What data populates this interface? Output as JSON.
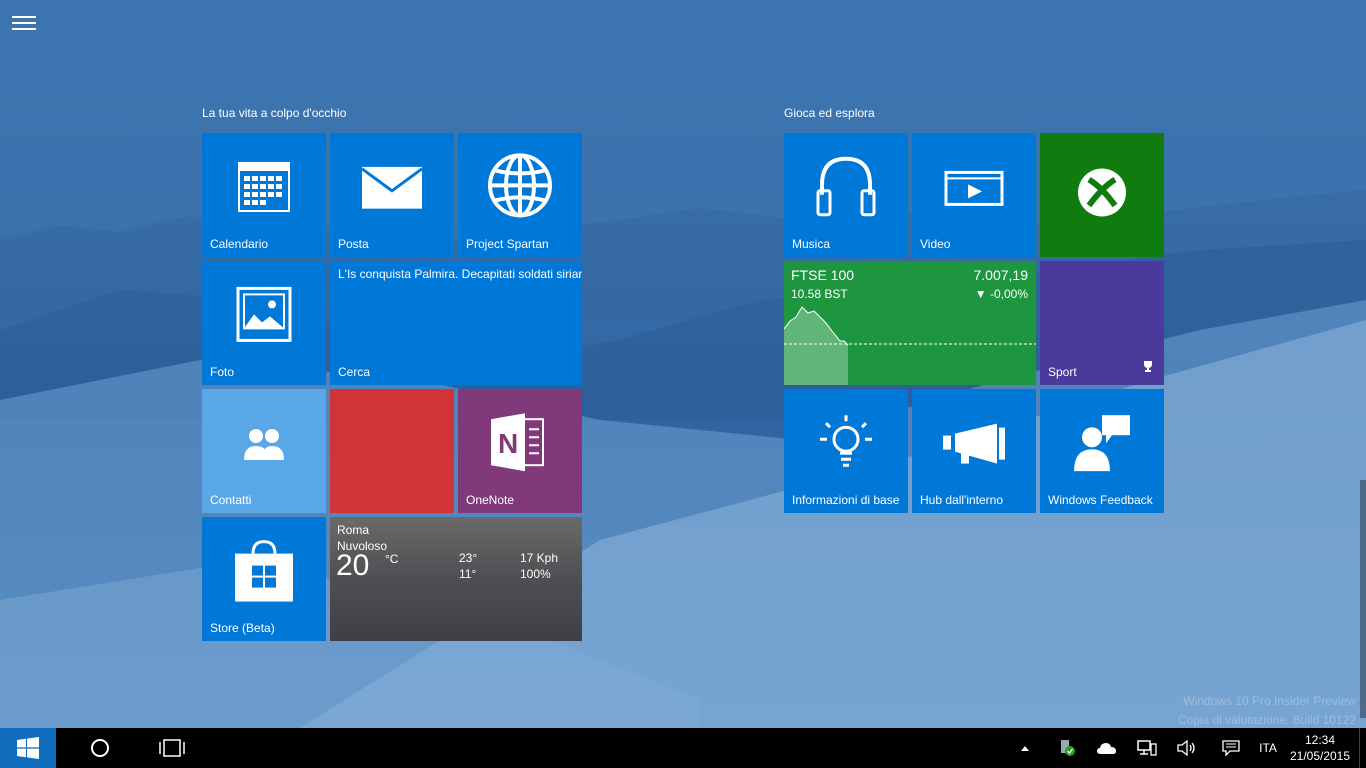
{
  "groups": {
    "left_title": "La tua vita a colpo d'occhio",
    "right_title": "Gioca ed esplora"
  },
  "tiles": {
    "calendar": "Calendario",
    "mail": "Posta",
    "spartan": "Project Spartan",
    "photos": "Foto",
    "search": "Cerca",
    "search_headline": "L'Is conquista Palmira. Decapitati soldati siriani",
    "contacts": "Contatti",
    "onenote": "OneNote",
    "store": "Store (Beta)",
    "music": "Musica",
    "video": "Video",
    "sport": "Sport",
    "tips": "Informazioni di base",
    "insider_hub": "Hub dall'interno",
    "feedback": "Windows Feedback"
  },
  "weather": {
    "city": "Roma",
    "condition": "Nuvoloso",
    "temp": "20",
    "unit": "°C",
    "high": "23°",
    "low": "11°",
    "wind": "17 Kph",
    "humidity": "100%"
  },
  "finance": {
    "index": "FTSE 100",
    "time": "10.58 BST",
    "value": "7.007,19",
    "change": "▼ -0,00%"
  },
  "taskbar": {
    "language": "ITA",
    "time": "12:34",
    "date": "21/05/2015"
  },
  "watermark": {
    "line1": "Windows 10 Pro Insider Preview",
    "line2": "Copia di valutazione. Build 10122"
  },
  "colors": {
    "accent": "#0078d7",
    "xbox": "#107c10",
    "sport": "#4b3a9b",
    "onenote": "#80397b",
    "red_tile": "#d13438",
    "contacts": "#5aa7e8",
    "finance": "#1e9640"
  }
}
